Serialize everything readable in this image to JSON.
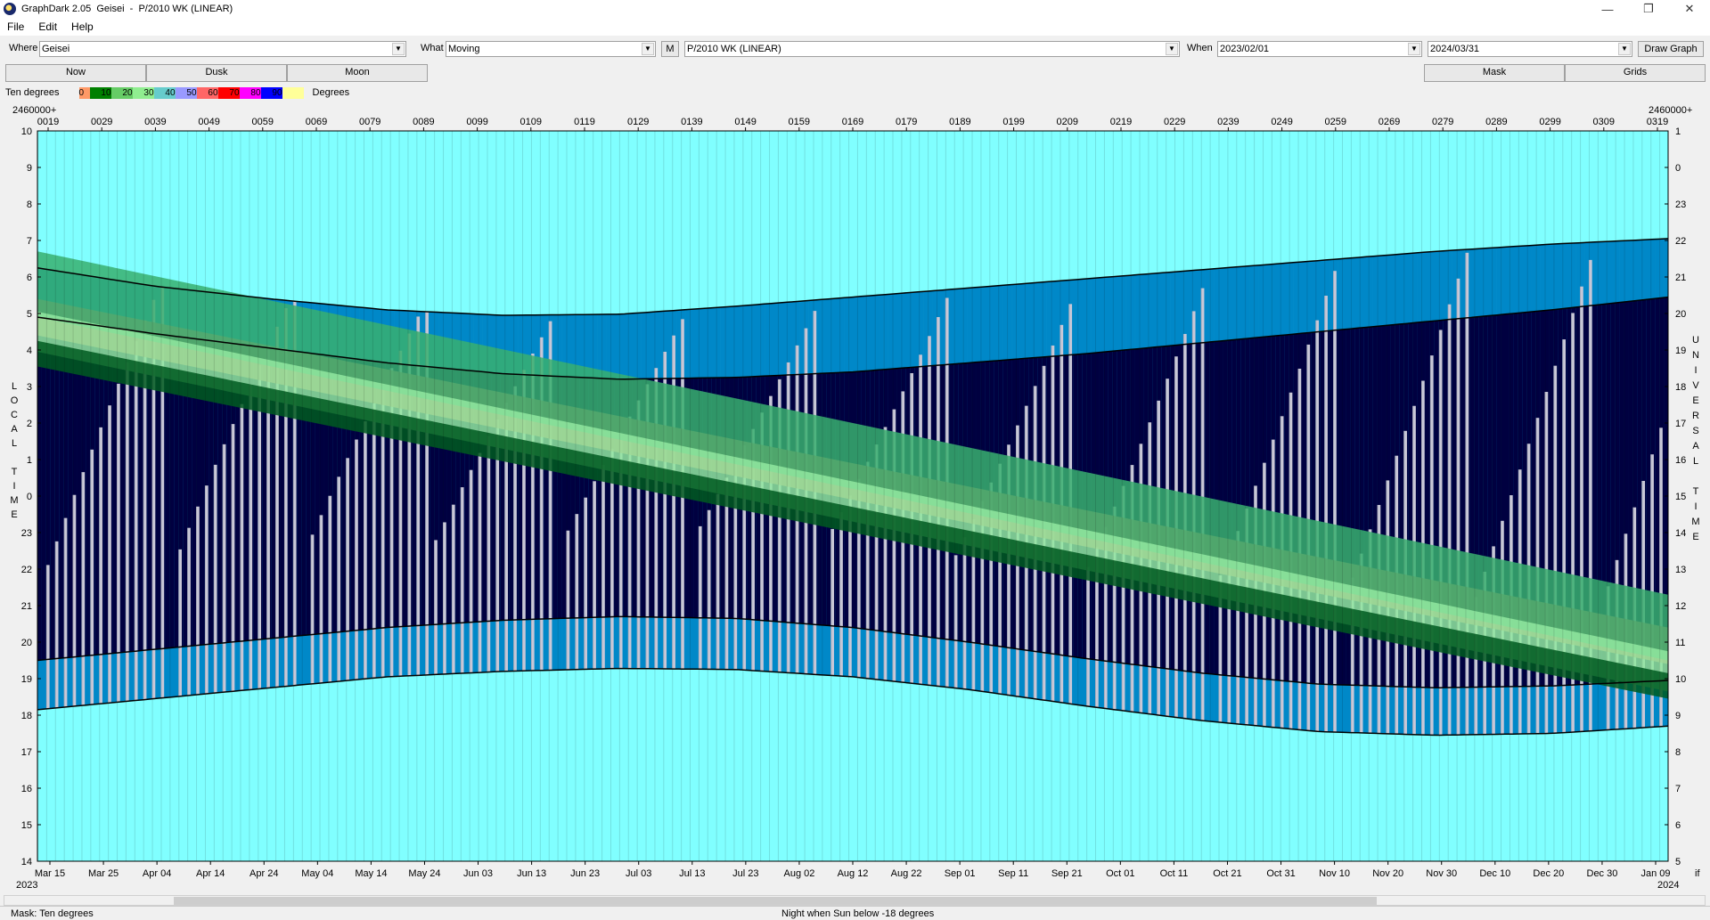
{
  "window": {
    "title": "GraphDark 2.05  Geisei  -  P/2010 WK (LINEAR)",
    "minimize": "—",
    "restore": "❐",
    "close": "✕"
  },
  "menu": [
    "File",
    "Edit",
    "Help"
  ],
  "toolbar": {
    "where_label": "Where",
    "where_value": "Geisei",
    "what_label": "What",
    "what_value": "Moving",
    "m_button": "M",
    "object_value": "P/2010 WK (LINEAR)",
    "when_label": "When",
    "date_from": "2023/02/01",
    "date_to": "2024/03/31",
    "draw_button": "Draw Graph"
  },
  "tabs": {
    "now": "Now",
    "dusk": "Dusk",
    "moon": "Moon",
    "mask": "Mask",
    "grids": "Grids"
  },
  "legend": {
    "title": "Ten degrees",
    "entries": [
      {
        "label": "0",
        "color": "#ff9966"
      },
      {
        "label": "10",
        "color": "#008000"
      },
      {
        "label": "20",
        "color": "#66cc66"
      },
      {
        "label": "30",
        "color": "#90ee90"
      },
      {
        "label": "40",
        "color": "#66cccc"
      },
      {
        "label": "50",
        "color": "#9999ff"
      },
      {
        "label": "60",
        "color": "#ff6666"
      },
      {
        "label": "70",
        "color": "#ff0000"
      },
      {
        "label": "80",
        "color": "#ff00ff"
      },
      {
        "label": "90",
        "color": "#0000ff"
      },
      {
        "label": "",
        "color": "#ffff99"
      }
    ],
    "unit": "Degrees"
  },
  "colors": {
    "day": "#80ffff",
    "twilight": "#0088c8",
    "night": "#000040",
    "moon": "#c8c8d8",
    "band_orange": "#f08060",
    "band_green": "#38b070",
    "band_light": "#90e8a0",
    "band_dark": "#005a20"
  },
  "chart_data": {
    "type": "area",
    "jd_offset_label_top": "2460000+",
    "jd_top_labels": [
      "0019",
      "0029",
      "0039",
      "0049",
      "0059",
      "0069",
      "0079",
      "0089",
      "0099",
      "0109",
      "0119",
      "0129",
      "0139",
      "0149",
      "0159",
      "0169",
      "0179",
      "0189",
      "0199",
      "0209",
      "0219",
      "0229",
      "0239",
      "0249",
      "0259",
      "0269",
      "0279",
      "0289",
      "0299",
      "0309",
      "0319"
    ],
    "jd_top_right": "2460000+",
    "x_dates": [
      "Mar 15",
      "Mar 25",
      "Apr 04",
      "Apr 14",
      "Apr 24",
      "May 04",
      "May 14",
      "May 24",
      "Jun 03",
      "Jun 13",
      "Jun 23",
      "Jul 03",
      "Jul 13",
      "Jul 23",
      "Aug 02",
      "Aug 12",
      "Aug 22",
      "Sep 01",
      "Sep 11",
      "Sep 21",
      "Oct 01",
      "Oct 11",
      "Oct 21",
      "Oct 31",
      "Nov 10",
      "Nov 20",
      "Nov 30",
      "Dec 10",
      "Dec 20",
      "Dec 30",
      "Jan 09"
    ],
    "year_left": "2023",
    "year_right": "2024",
    "corner_right": "if",
    "left_axis_label": "LOCAL TIME",
    "left_ticks": [
      "10",
      "9",
      "8",
      "7",
      "6",
      "5",
      "4",
      "3",
      "2",
      "1",
      "0",
      "23",
      "22",
      "21",
      "20",
      "19",
      "18",
      "17",
      "16",
      "15",
      "14"
    ],
    "right_axis_label": "UNIVERSAL TIME",
    "right_ticks": [
      "1",
      "0",
      "23",
      "22",
      "21",
      "20",
      "19",
      "18",
      "17",
      "16",
      "15",
      "14",
      "13",
      "12",
      "11",
      "10",
      "9",
      "8",
      "7",
      "6",
      "5"
    ],
    "sunset_local": [
      18.15,
      18.45,
      18.75,
      19.05,
      19.2,
      19.28,
      19.25,
      19.05,
      18.7,
      18.25,
      17.85,
      17.55,
      17.45,
      17.5,
      17.7
    ],
    "sunrise_local": [
      6.25,
      5.75,
      5.4,
      5.1,
      4.95,
      4.98,
      5.2,
      5.45,
      5.7,
      5.95,
      6.2,
      6.45,
      6.7,
      6.9,
      7.05
    ],
    "dusk_local": [
      19.5,
      19.8,
      20.1,
      20.4,
      20.6,
      20.7,
      20.65,
      20.4,
      20.0,
      19.55,
      19.15,
      18.85,
      18.75,
      18.8,
      18.95
    ],
    "dawn_local": [
      4.9,
      4.45,
      4.05,
      3.65,
      3.35,
      3.2,
      3.25,
      3.4,
      3.65,
      3.9,
      4.2,
      4.5,
      4.8,
      5.1,
      5.45
    ],
    "status_left": "Mask:  Ten degrees",
    "status_center": "Night when Sun below -18 degrees"
  }
}
